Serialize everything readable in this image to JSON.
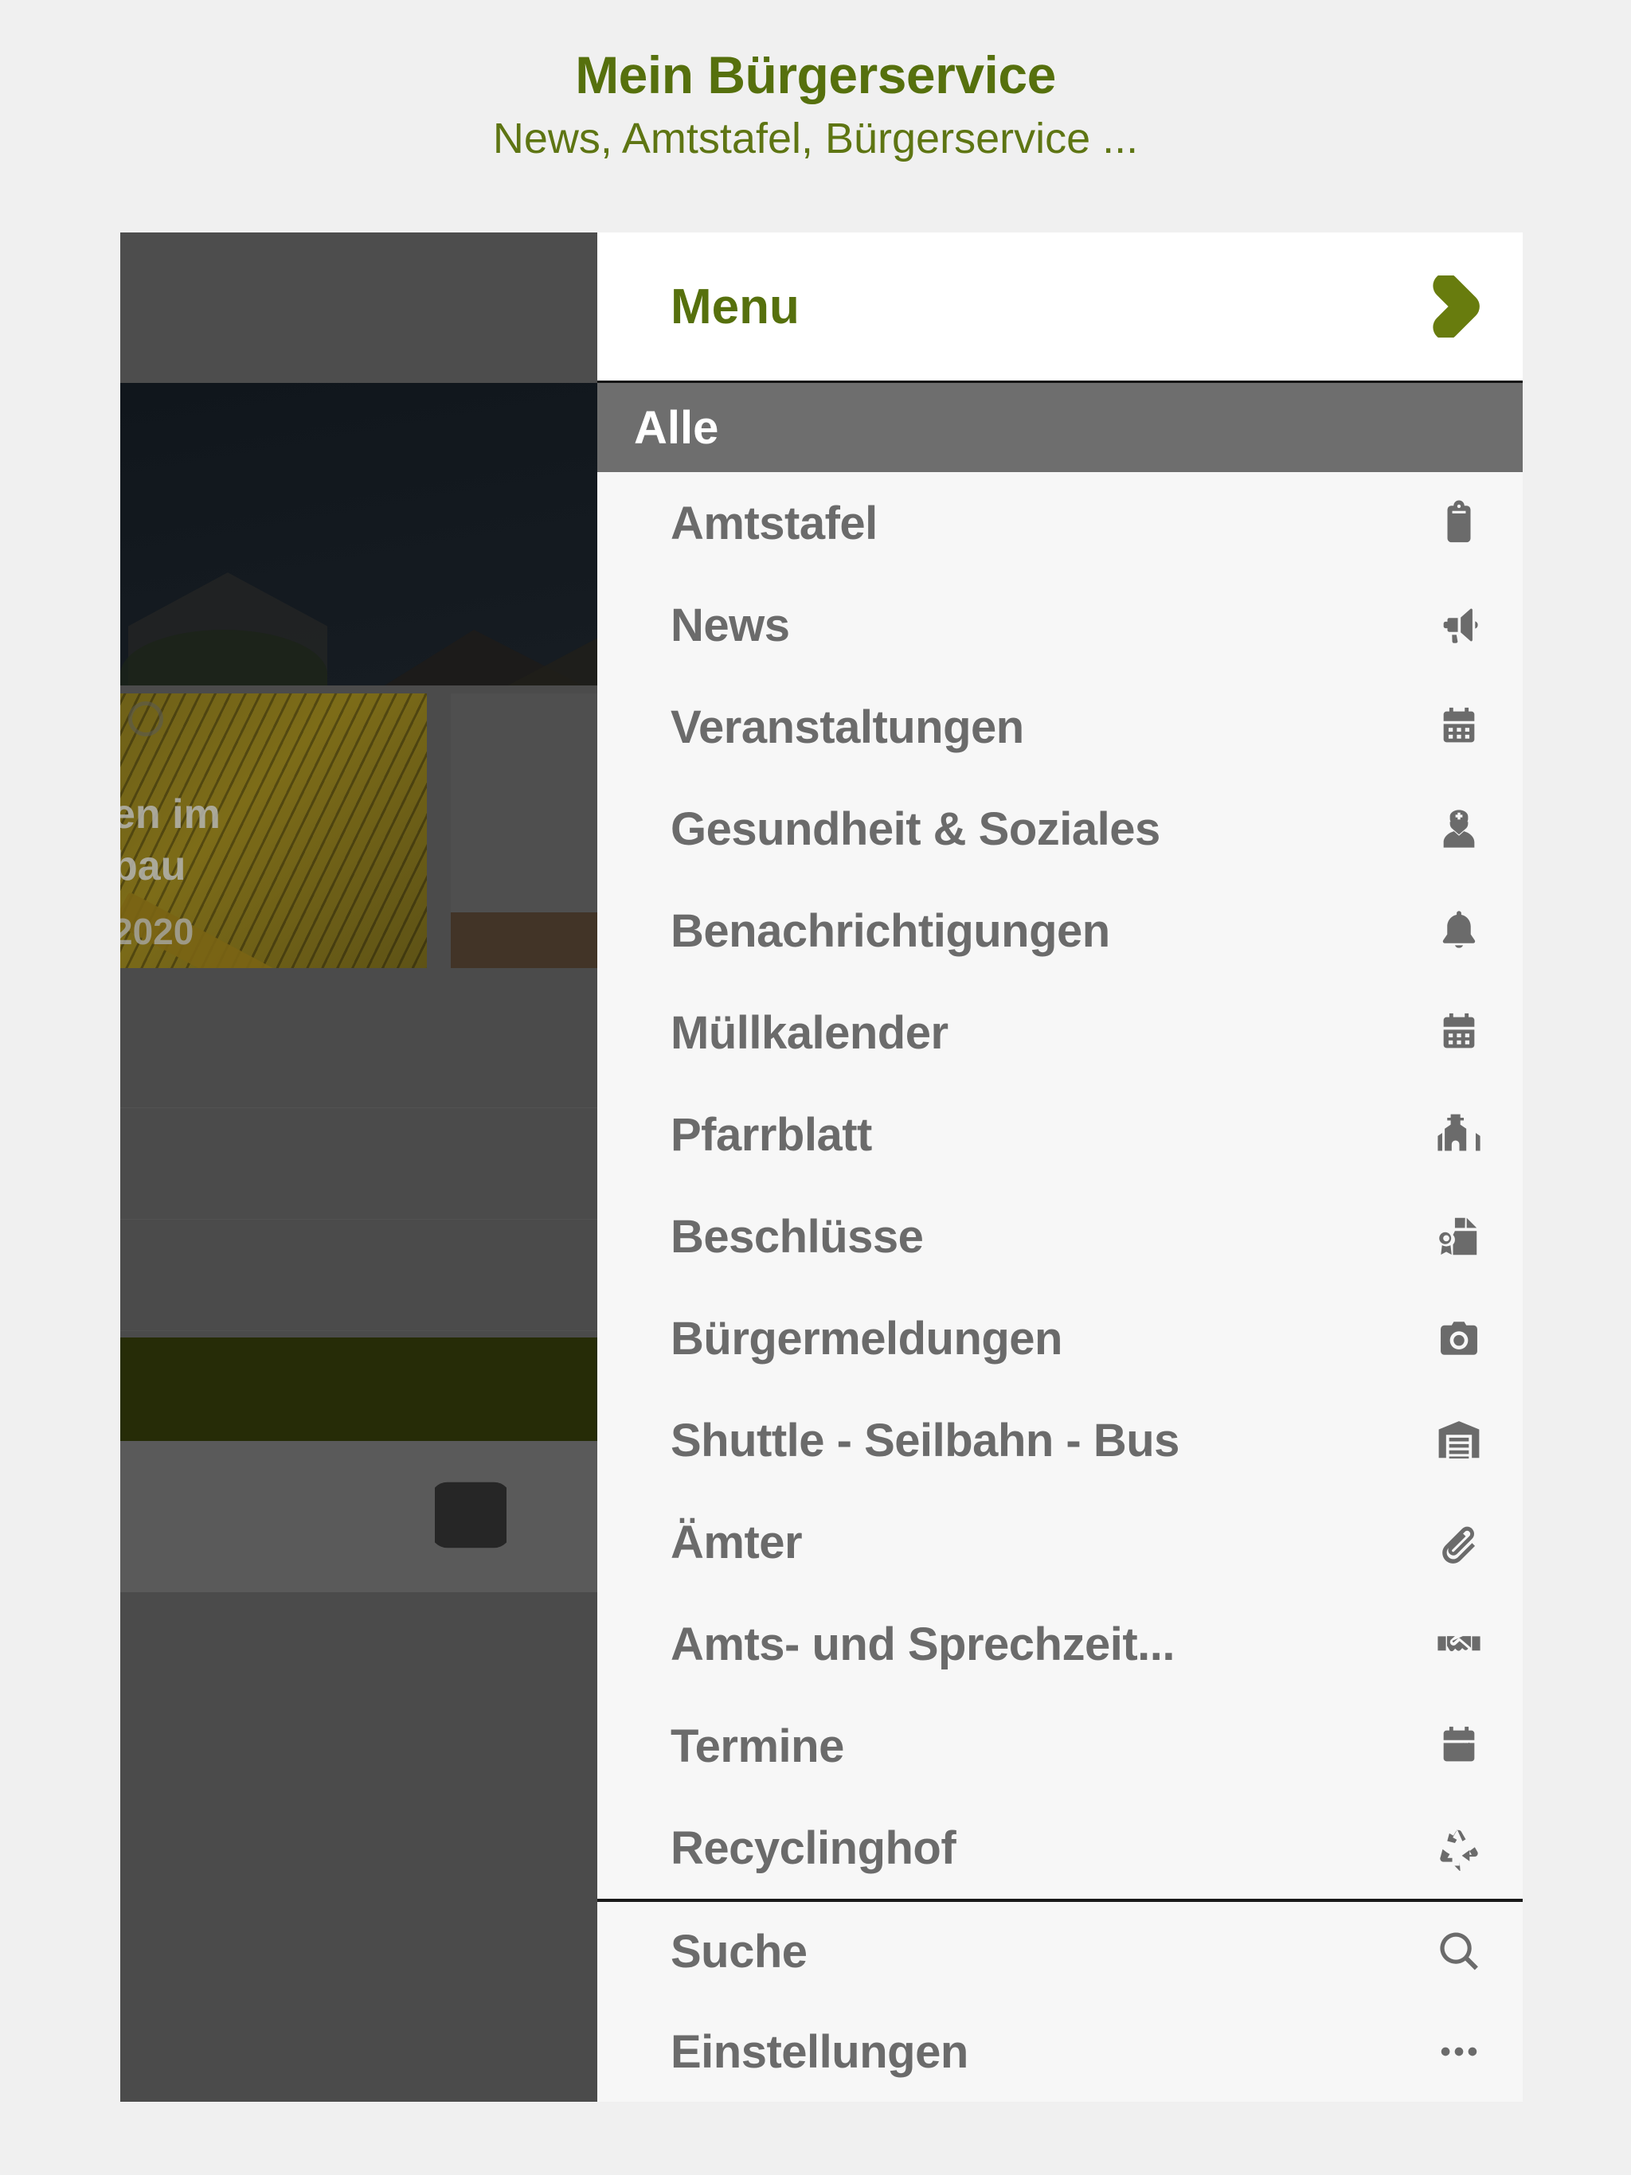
{
  "header": {
    "title": "Mein Bürgerservice",
    "subtitle": "News, Amtstafel, Bürgerservice ..."
  },
  "colors": {
    "brand_olive": "#56700d",
    "page_background": "#f0f0f0",
    "drawer_background": "#f7f7f7",
    "section_header_background": "#6e6e6e",
    "menu_text": "#6b6b6b",
    "green_bar": "#262c07",
    "dim_overlay": "#4b4b4b"
  },
  "drawer": {
    "header": {
      "label": "Menu",
      "expand_icon": "chevron-right-icon"
    },
    "section": {
      "label": "Alle"
    },
    "items": [
      {
        "label": "Amtstafel",
        "icon": "clipboard-icon"
      },
      {
        "label": "News",
        "icon": "megaphone-icon"
      },
      {
        "label": "Veranstaltungen",
        "icon": "calendar-icon"
      },
      {
        "label": "Gesundheit & Soziales",
        "icon": "nurse-icon"
      },
      {
        "label": "Benachrichtigungen",
        "icon": "bell-icon"
      },
      {
        "label": "Müllkalender",
        "icon": "calendar-icon"
      },
      {
        "label": "Pfarrblatt",
        "icon": "church-icon"
      },
      {
        "label": "Beschlüsse",
        "icon": "certificate-icon"
      },
      {
        "label": "Bürgermeldungen",
        "icon": "camera-icon"
      },
      {
        "label": "Shuttle - Seilbahn - Bus",
        "icon": "warehouse-icon"
      },
      {
        "label": "Ämter",
        "icon": "paperclip-icon"
      },
      {
        "label": "Amts- und Sprechzeit...",
        "icon": "handshake-icon"
      },
      {
        "label": "Termine",
        "icon": "calendar-edit-icon"
      },
      {
        "label": "Recyclinghof",
        "icon": "recycle-icon"
      }
    ],
    "footer_items": [
      {
        "label": "Suche",
        "icon": "search-icon"
      },
      {
        "label": "Einstellungen",
        "icon": "ellipsis-icon"
      }
    ]
  },
  "background_app": {
    "card": {
      "title_fragment_line1": "en im",
      "title_fragment_line2": "bau",
      "date_fragment": "2020"
    },
    "list_icons": [
      "clipboard-icon",
      "megaphone-icon",
      "calendar-icon"
    ],
    "green_bar_icon": "map-icon",
    "bottom_nav_icons": [
      "mail-icon",
      "hamburger-menu-icon"
    ]
  }
}
